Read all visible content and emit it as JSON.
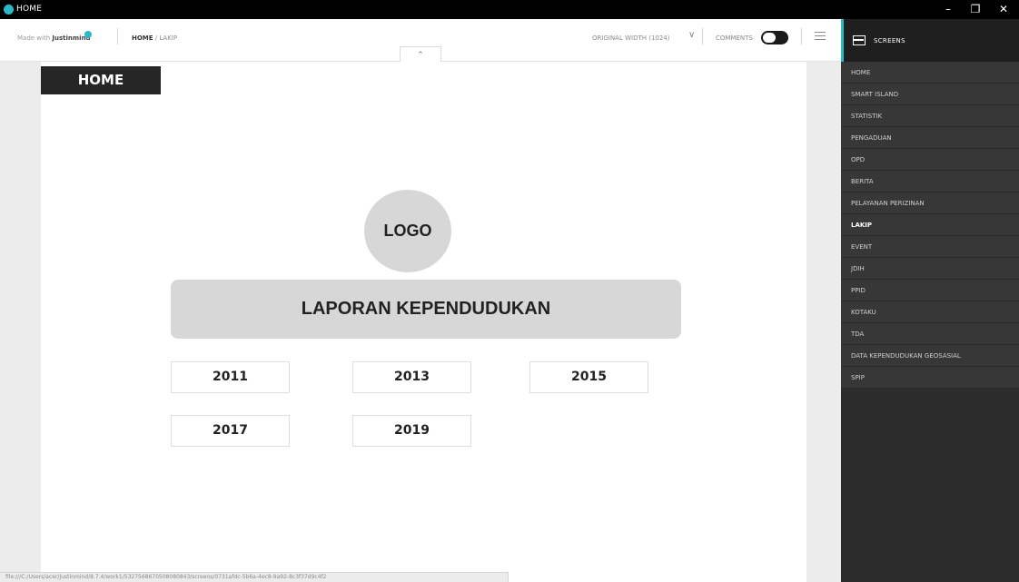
{
  "window": {
    "title": "HOME",
    "minimize_label": "–",
    "maximize_label": "❐",
    "close_label": "✕"
  },
  "toolbar": {
    "made_with_prefix": "Made with",
    "made_with_brand": "Justinmind",
    "breadcrumb_home": "HOME",
    "breadcrumb_rest": " / LAKIP",
    "width_label": "ORIGINAL WIDTH (1024)",
    "width_chevron": "∨",
    "comments_label": "COMMENTS",
    "collapse_label": "⌃"
  },
  "page": {
    "home_tab": "HOME",
    "logo": "LOGO",
    "banner": "LAPORAN KEPENDUDUKAN",
    "years": [
      "2011",
      "2013",
      "2015",
      "2017",
      "2019"
    ]
  },
  "status_url": "file:///C:/Users/acer/Justinmind/8.7.4/work1/5327568670508080843/screens/0731afdc-5b6a-4ec8-9a92-8c3f37d9c4f2",
  "panel": {
    "title": "SCREENS",
    "items": [
      "HOME",
      "SMART ISLAND",
      "STATISTIK",
      "PENGADUAN",
      "OPD",
      "BERITA",
      "PELAYANAN PERIZINAN",
      "LAKIP",
      "EVENT",
      "JDIH",
      "PPID",
      "KOTAKU",
      "TDA",
      "DATA KEPENDUDUKAN GEOSASIAL",
      "SPIP"
    ],
    "active_item": "LAKIP"
  },
  "colors": {
    "accent": "#2bb9c9",
    "panel_bg": "#2c2c2c",
    "title_bar": "#000000",
    "placeholder_gray": "#d7d7d7"
  }
}
